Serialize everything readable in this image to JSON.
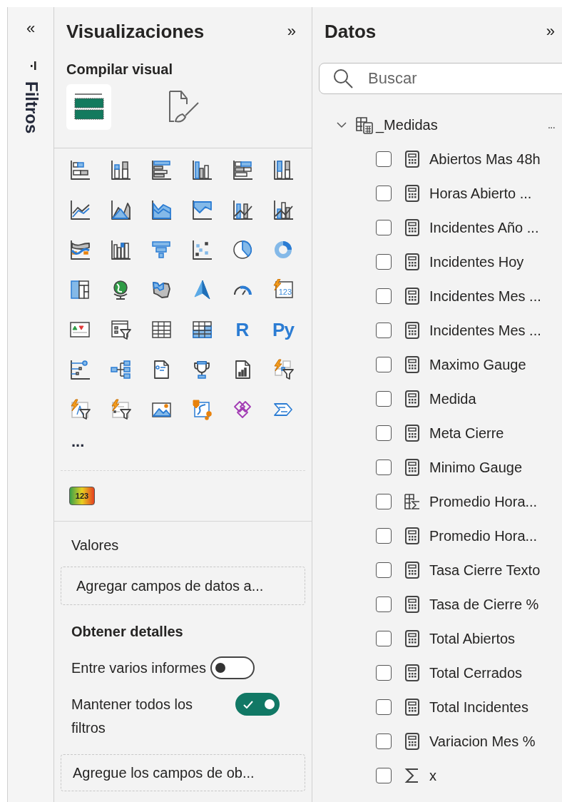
{
  "filters_strip": {
    "collapse": "«",
    "title": "Filtros"
  },
  "visualizations": {
    "title": "Visualizaciones",
    "expand": "»",
    "section": "Compilar visual",
    "tabs": [
      {
        "kind": "build",
        "selected": true
      },
      {
        "kind": "format",
        "selected": false
      }
    ],
    "gallery": {
      "card_digits": "123",
      "r_label": "R",
      "python_label": "Py",
      "more": "...",
      "custom_digits": "123"
    },
    "values": {
      "label": "Valores",
      "drop_hint": "Agregar campos de datos a..."
    },
    "drillthrough": {
      "title": "Obtener detalles",
      "options": [
        {
          "label": "Entre varios informes",
          "on": false
        },
        {
          "label": "Mantener todos los filtros",
          "on": true
        }
      ],
      "drop_hint": "Agregue los campos de ob..."
    }
  },
  "data": {
    "title": "Datos",
    "expand": "»",
    "search": {
      "placeholder": "Buscar"
    },
    "tables": [
      {
        "name": "_Medidas",
        "expanded": true,
        "more": "...",
        "fields": [
          {
            "name": "Abiertos Mas 48h",
            "kind": "measure",
            "checked": false
          },
          {
            "name": "Horas Abierto ...",
            "kind": "measure",
            "checked": false
          },
          {
            "name": "Incidentes Año ...",
            "kind": "measure",
            "checked": false
          },
          {
            "name": "Incidentes Hoy",
            "kind": "measure",
            "checked": false
          },
          {
            "name": "Incidentes Mes ...",
            "kind": "measure",
            "checked": false
          },
          {
            "name": "Incidentes Mes ...",
            "kind": "measure",
            "checked": false
          },
          {
            "name": "Maximo Gauge",
            "kind": "measure",
            "checked": false
          },
          {
            "name": "Medida",
            "kind": "measure",
            "checked": false
          },
          {
            "name": "Meta Cierre",
            "kind": "measure",
            "checked": false
          },
          {
            "name": "Minimo Gauge",
            "kind": "measure",
            "checked": false
          },
          {
            "name": "Promedio Hora...",
            "kind": "calculated_column",
            "checked": false
          },
          {
            "name": "Promedio Hora...",
            "kind": "measure",
            "checked": false
          },
          {
            "name": "Tasa Cierre Texto",
            "kind": "measure",
            "checked": false
          },
          {
            "name": "Tasa de Cierre %",
            "kind": "measure",
            "checked": false
          },
          {
            "name": "Total Abiertos",
            "kind": "measure",
            "checked": false
          },
          {
            "name": "Total Cerrados",
            "kind": "measure",
            "checked": false
          },
          {
            "name": "Total Incidentes",
            "kind": "measure",
            "checked": false
          },
          {
            "name": "Variacion Mes %",
            "kind": "measure",
            "checked": false
          },
          {
            "name": "x",
            "kind": "sum",
            "checked": false
          }
        ]
      }
    ]
  }
}
